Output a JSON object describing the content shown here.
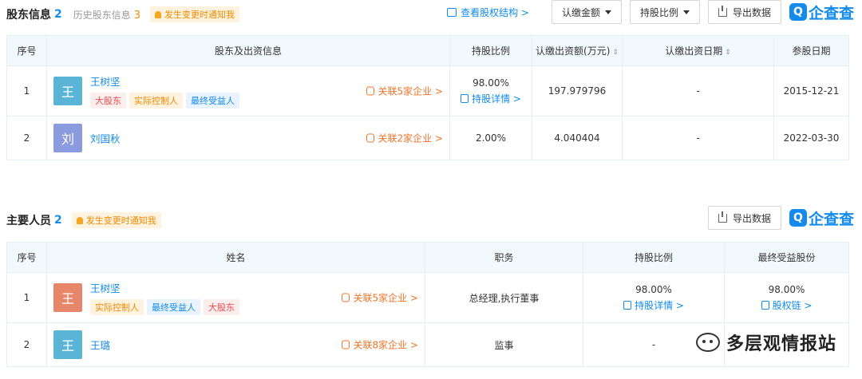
{
  "shareholders": {
    "title": "股东信息",
    "count": "2",
    "history_label": "历史股东信息",
    "history_count": "3",
    "notice": "发生变更时通知我",
    "view_structure": "查看股权结构 >",
    "filter_amount": "认缴金额",
    "filter_ratio": "持股比例",
    "export": "导出数据",
    "columns": [
      "序号",
      "股东及出资信息",
      "持股比例",
      "认缴出资额(万元)",
      "认缴出资日期",
      "参股日期"
    ],
    "rows": [
      {
        "index": "1",
        "avatar": "王",
        "avatar_color": "#5ab4d6",
        "name": "王树坚",
        "tags": [
          "大股东",
          "实际控制人",
          "最终受益人"
        ],
        "related": "关联5家企业 >",
        "ratio": "98.00%",
        "detail": "持股详情 >",
        "amount": "197.979796",
        "subscribe_date": "-",
        "join_date": "2015-12-21"
      },
      {
        "index": "2",
        "avatar": "刘",
        "avatar_color": "#8b9be0",
        "name": "刘国秋",
        "tags": [],
        "related": "关联2家企业 >",
        "ratio": "2.00%",
        "amount": "4.040404",
        "subscribe_date": "-",
        "join_date": "2022-03-30"
      }
    ]
  },
  "personnel": {
    "title": "主要人员",
    "count": "2",
    "notice": "发生变更时通知我",
    "export": "导出数据",
    "columns": [
      "序号",
      "姓名",
      "职务",
      "持股比例",
      "最终受益股份"
    ],
    "rows": [
      {
        "index": "1",
        "avatar": "王",
        "avatar_color": "#e8866a",
        "name": "王树坚",
        "tags": [
          "实际控制人",
          "最终受益人",
          "大股东"
        ],
        "related": "关联5家企业 >",
        "position": "总经理,执行董事",
        "ratio": "98.00%",
        "detail": "持股详情 >",
        "benefit": "98.00%",
        "chain": "股权链 >"
      },
      {
        "index": "2",
        "avatar": "王",
        "avatar_color": "#5ab4d6",
        "name": "王璐",
        "tags": [],
        "related": "关联8家企业 >",
        "position": "监事",
        "ratio": "-",
        "benefit": "-"
      }
    ]
  },
  "brand": "企查查",
  "watermark": "多层观情报站",
  "colors": {
    "accent": "#128bed",
    "orange": "#f0742a",
    "header_bg": "#f2f9fc"
  }
}
